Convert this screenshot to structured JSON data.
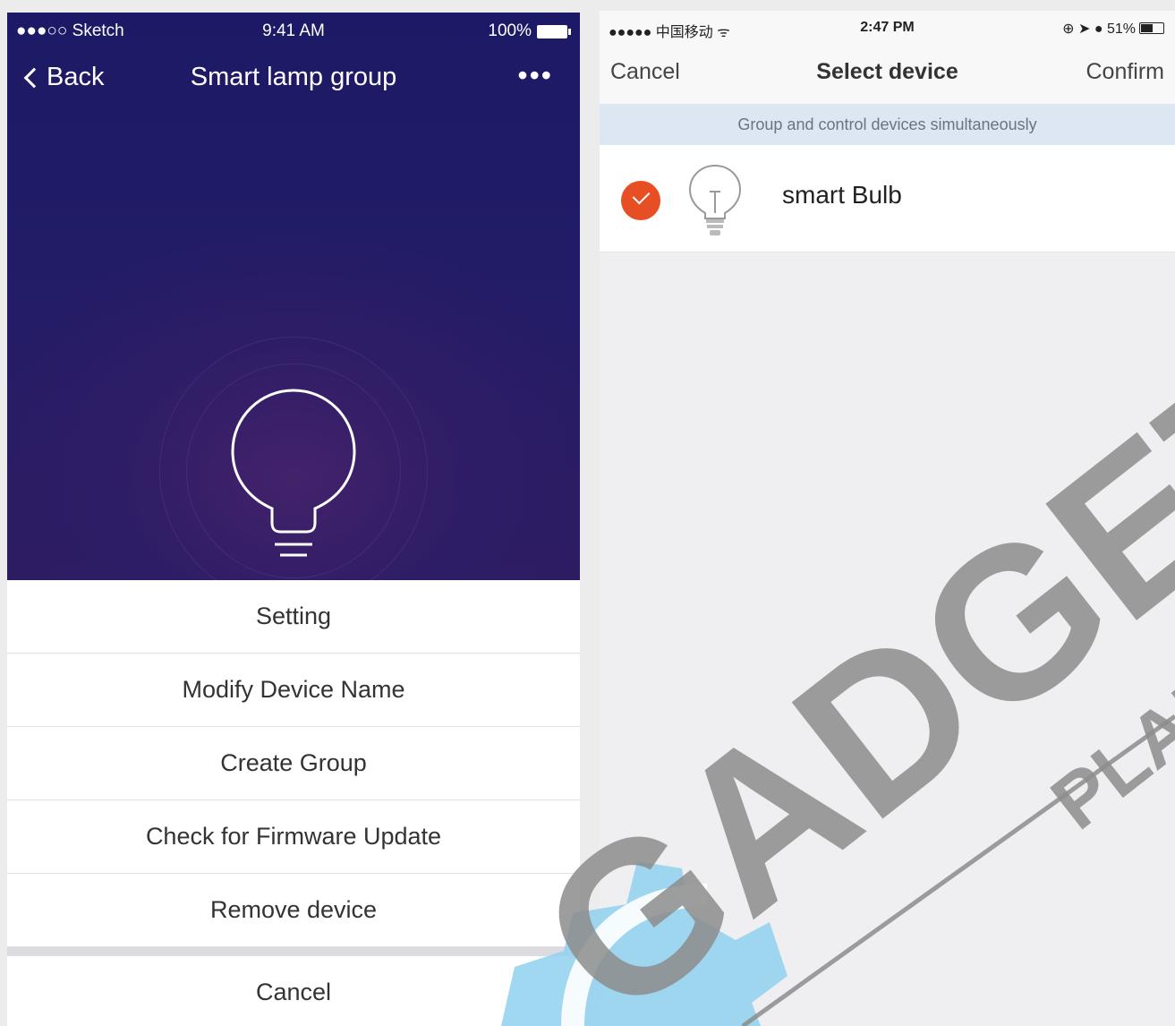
{
  "left_screen": {
    "status_bar": {
      "carrier": "●●●○○ Sketch",
      "time": "9:41 AM",
      "battery": "100%"
    },
    "nav": {
      "back_label": "Back",
      "title": "Smart lamp group",
      "more": "•••"
    },
    "menu": [
      {
        "label": "Setting"
      },
      {
        "label": "Modify Device Name"
      },
      {
        "label": "Create Group"
      },
      {
        "label": "Check for Firmware Update"
      },
      {
        "label": "Remove device"
      }
    ],
    "cancel_label": "Cancel"
  },
  "right_screen": {
    "status_bar": {
      "carrier": "●●●●● 中国移动",
      "time": "2:47 PM",
      "status_right": "51%"
    },
    "nav": {
      "cancel": "Cancel",
      "title": "Select device",
      "confirm": "Confirm"
    },
    "banner": "Group and control devices simultaneously",
    "devices": [
      {
        "name": "smart Bulb",
        "selected": true
      }
    ]
  },
  "watermark": {
    "text_main": "GADGET",
    "text_sub": "PLAN"
  },
  "colors": {
    "hero_top": "#1c1a66",
    "hero_bottom": "#2e1c62",
    "check": "#e84e23",
    "banner": "#dde7f3"
  }
}
